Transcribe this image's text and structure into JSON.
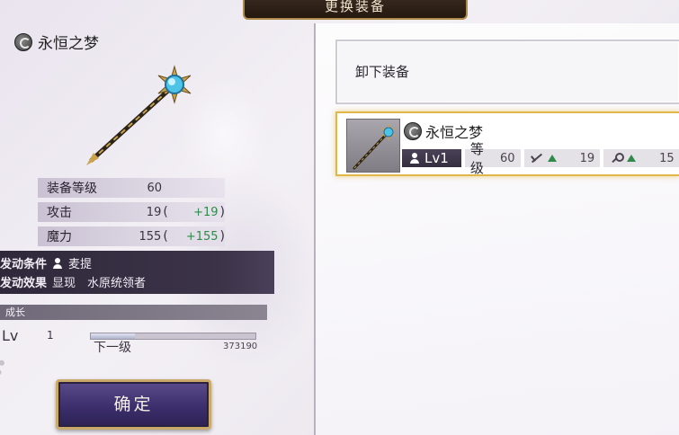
{
  "header": {
    "title": "更换装备"
  },
  "detail": {
    "item_name": "永恒之梦",
    "type_icon": "staff-type-icon",
    "stats": [
      {
        "label": "装备等级",
        "value": "60",
        "bonus": ""
      },
      {
        "label": "攻击",
        "value": "19",
        "bonus": "+19"
      },
      {
        "label": "魔力",
        "value": "155",
        "bonus": "+155"
      }
    ],
    "conditions": {
      "trigger_label": "发动条件",
      "trigger_value": "麦提",
      "effect_label": "发动效果",
      "effect_value": "显现　水原统领者"
    },
    "growth": {
      "header": "成长",
      "lv_label": "Lv",
      "lv_value": "1",
      "next_label": "下一级",
      "exp_total": "373190",
      "exp_progress": 0.27
    },
    "confirm_label": "确定"
  },
  "list": {
    "unequip_label": "卸下装备",
    "items": [
      {
        "name": "永恒之梦",
        "lv_label": "Lv1",
        "level_label": "等级",
        "level_value": "60",
        "attack_value": "19",
        "magic_value": "15"
      }
    ]
  },
  "colors": {
    "bonus_green": "#2f8a4a",
    "selected_border": "#e0b84a",
    "button_purple": "#3a2d6a"
  }
}
